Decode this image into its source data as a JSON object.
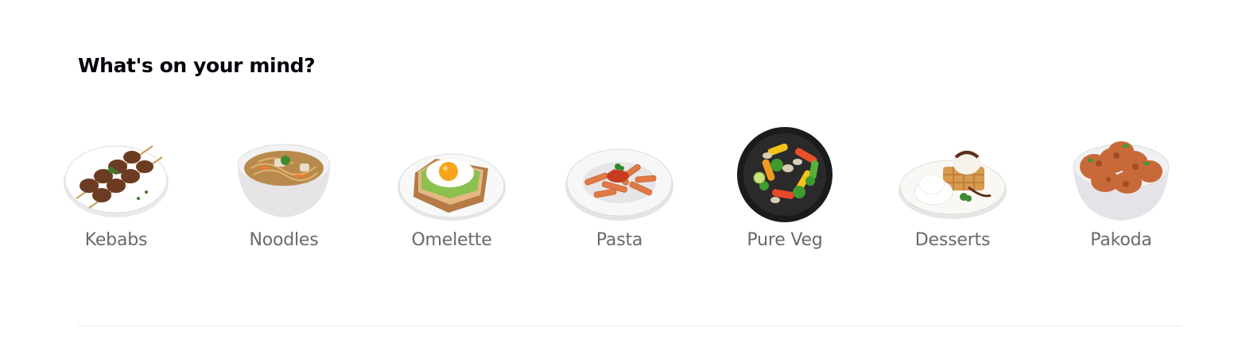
{
  "section": {
    "title": "What's on your mind?"
  },
  "categories": [
    {
      "label": "Kebabs",
      "icon": "kebabs-plate"
    },
    {
      "label": "Noodles",
      "icon": "noodles-bowl"
    },
    {
      "label": "Omelette",
      "icon": "egg-avocado-toast"
    },
    {
      "label": "Pasta",
      "icon": "penne-pasta-plate"
    },
    {
      "label": "Pure Veg",
      "icon": "stir-fry-veg-pan"
    },
    {
      "label": "Desserts",
      "icon": "waffle-icecream-plate"
    },
    {
      "label": "Pakoda",
      "icon": "pakoda-bowl"
    }
  ]
}
